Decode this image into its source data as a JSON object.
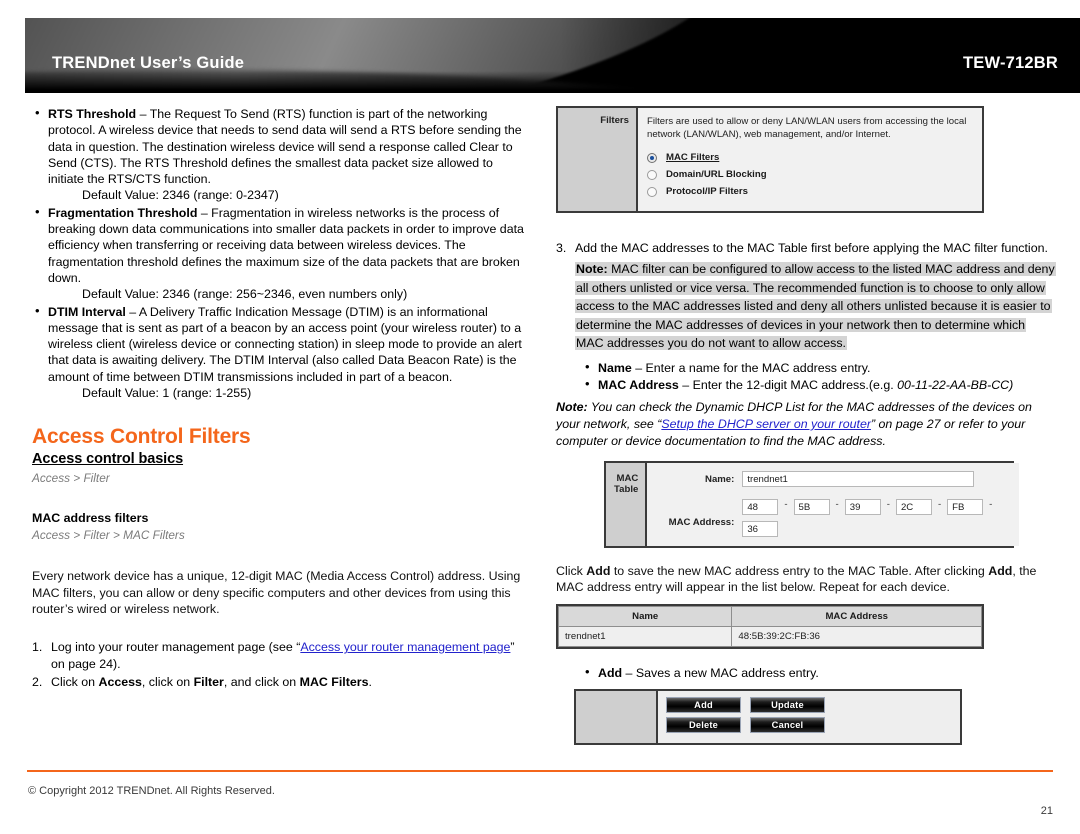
{
  "header": {
    "guide_title": "TRENDnet User’s Guide",
    "model": "TEW-712BR",
    "accent_color": "#F4661B"
  },
  "left_column": {
    "bullets": [
      {
        "term": "RTS Threshold",
        "dash": " – ",
        "text": "The Request To Send (RTS) function is part of the networking protocol. A wireless device that needs to send data will send a RTS before sending the data in question. The destination wireless device will send a response called Clear to Send (CTS). The RTS Threshold defines the smallest data packet size allowed to initiate the RTS/CTS function.",
        "default": "Default Value: 2346 (range: 0-2347)"
      },
      {
        "term": "Fragmentation Threshold",
        "dash": " – ",
        "text": "Fragmentation in wireless networks is the process of breaking down data communications into smaller data packets in order to improve data efficiency when transferring or receiving data between wireless devices. The fragmentation threshold defines the maximum size of the data packets that are broken down.",
        "default": "Default Value: 2346 (range: 256~2346, even numbers only)"
      },
      {
        "term": "DTIM Interval",
        "dash": " – ",
        "text": "A Delivery Traffic Indication Message (DTIM) is an informational message that is sent as part of a beacon by an access point (your wireless router) to a wireless client (wireless device or connecting station) in sleep mode to provide an alert that data is awaiting delivery. The DTIM Interval (also called Data Beacon Rate) is the amount of time between DTIM transmissions included in part of a beacon.",
        "default": "Default Value: 1 (range: 1-255)"
      }
    ],
    "section_title": "Access Control Filters",
    "subsection_title": "Access control basics",
    "subsection_path": "Access > Filter",
    "topic_title": "MAC address filters",
    "topic_path": "Access > Filter > MAC Filters",
    "intro_paragraph": "Every network device has a unique, 12-digit MAC (Media Access Control) address. Using MAC filters, you can allow or deny specific computers and other devices from using this router’s wired or wireless network.",
    "step1_pre": "Log into your router management page (see “",
    "step1_link": "Access your router management page",
    "step1_post": "” on page 24).",
    "step2_pre": "Click on ",
    "step2_b1": "Access",
    "step2_mid1": ", click on ",
    "step2_b2": "Filter",
    "step2_mid2": ", and click on ",
    "step2_b3": "MAC Filters",
    "step2_post": "."
  },
  "right_column": {
    "filters_widget": {
      "label": "Filters",
      "description": "Filters are used to allow or deny LAN/WLAN users from accessing the local network (LAN/WLAN), web management, and/or Internet.",
      "options": [
        {
          "label": "MAC Filters",
          "selected": true
        },
        {
          "label": "Domain/URL Blocking",
          "selected": false
        },
        {
          "label": "Protocol/IP Filters",
          "selected": false
        }
      ]
    },
    "step3": "Add the MAC addresses to the MAC Table first before applying the MAC filter function.",
    "note1_label": "Note:",
    "note1_text": " MAC filter can be configured to allow access to the listed MAC address and deny all others unlisted or vice versa. The recommended function is to choose to only allow access to the MAC addresses listed and deny all others unlisted because it is easier to determine the MAC addresses of devices in your network then to determine which MAC addresses you do not want to allow access.",
    "field_bullets": [
      {
        "term": "Name",
        "dash": " – ",
        "text": "Enter a name for the MAC address entry.",
        "example": ""
      },
      {
        "term": "MAC Address",
        "dash": " – ",
        "text": "Enter the 12-digit MAC address.(e.g. ",
        "example": "00-11-22-AA-BB-CC)"
      }
    ],
    "note2_label": "Note:",
    "note2_pre": " You can check the Dynamic DHCP List for the MAC addresses of the devices on your network, see “",
    "note2_link": "Setup the DHCP server on your router",
    "note2_post": "” on page 27 or refer to your computer or device documentation to find the MAC address.",
    "mac_table_widget": {
      "label": "MAC Table",
      "name_label": "Name:",
      "name_value": "trendnet1",
      "mac_label": "MAC Address:",
      "octets": [
        "48",
        "5B",
        "39",
        "2C",
        "FB",
        "36"
      ],
      "separator": "-"
    },
    "add_paragraph_p1": "Click ",
    "add_paragraph_b1": "Add",
    "add_paragraph_p2": " to save the new MAC address entry to the MAC Table. After clicking ",
    "add_paragraph_b2": "Add",
    "add_paragraph_p3": ", the MAC address entry will appear in the list below. Repeat for each device.",
    "list_table": {
      "headers": [
        "Name",
        "MAC Address"
      ],
      "rows": [
        [
          "trendnet1",
          "48:5B:39:2C:FB:36"
        ]
      ]
    },
    "add_bullet": {
      "term": "Add",
      "dash": " – ",
      "text": "Saves a new MAC address entry."
    },
    "buttons": [
      [
        "Add",
        "Update"
      ],
      [
        "Delete",
        "Cancel"
      ]
    ]
  },
  "footer": {
    "copyright": "© Copyright 2012 TRENDnet. All Rights Reserved.",
    "page_number": "21"
  }
}
